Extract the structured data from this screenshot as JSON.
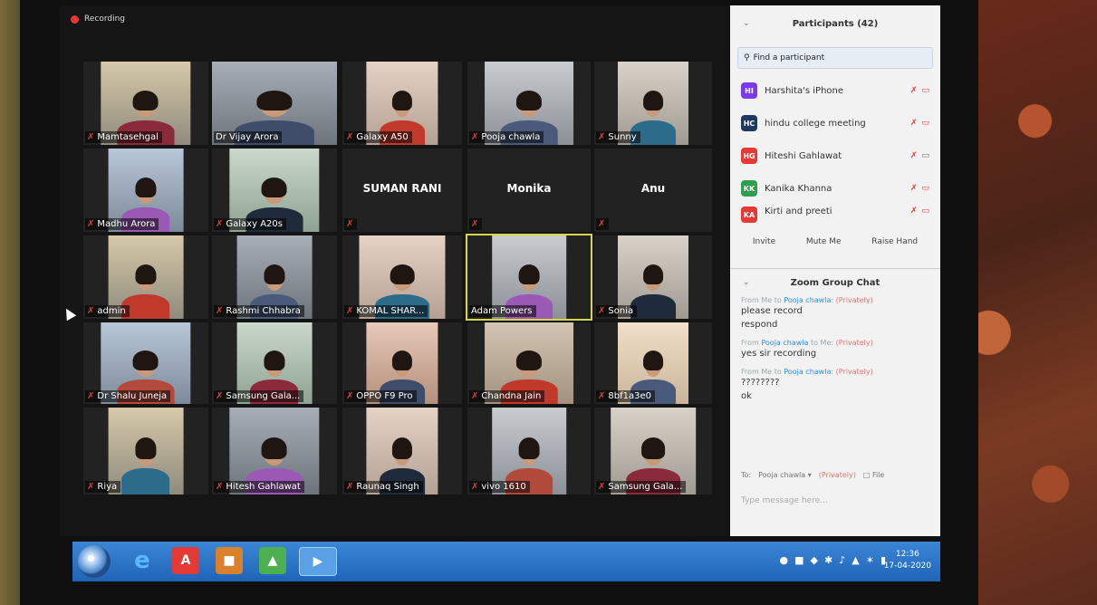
{
  "recording_label": "Recording",
  "video_tiles": [
    {
      "name": "Mamtasehgal",
      "muted": true
    },
    {
      "name": "Dr Vijay Arora",
      "muted": false
    },
    {
      "name": "Galaxy A50",
      "muted": true
    },
    {
      "name": "Pooja chawla",
      "muted": true
    },
    {
      "name": "Sunny",
      "muted": true
    },
    {
      "name": "Madhu Arora",
      "muted": true
    },
    {
      "name": "Galaxy A20s",
      "muted": true
    },
    {
      "name": "SUMAN RANI",
      "muted": true,
      "video_off": true
    },
    {
      "name": "Monika",
      "muted": true,
      "video_off": true
    },
    {
      "name": "Anu",
      "muted": true,
      "video_off": true
    },
    {
      "name": "admin",
      "muted": true
    },
    {
      "name": "Rashmi Chhabra",
      "muted": true
    },
    {
      "name": "KOMAL SHAR...",
      "muted": true
    },
    {
      "name": "Adam Powers",
      "muted": false,
      "active_speaker": true
    },
    {
      "name": "Sonia",
      "muted": true
    },
    {
      "name": "Dr Shalu Juneja",
      "muted": true
    },
    {
      "name": "Samsung Gala...",
      "muted": true
    },
    {
      "name": "OPPO F9 Pro",
      "muted": true
    },
    {
      "name": "Chandna Jain",
      "muted": true
    },
    {
      "name": "8bf1a3e0",
      "muted": true
    },
    {
      "name": "Riya",
      "muted": true
    },
    {
      "name": "Hitesh Gahlawat",
      "muted": true
    },
    {
      "name": "Raunaq Singh",
      "muted": true
    },
    {
      "name": "vivo 1610",
      "muted": true
    },
    {
      "name": "Samsung Gala...",
      "muted": true
    }
  ],
  "participants_panel": {
    "title": "Participants (42)",
    "search_placeholder": "Find a participant",
    "participants": [
      {
        "initials": "HI",
        "name": "Harshita's iPhone",
        "color": "#7c3aed"
      },
      {
        "initials": "HC",
        "name": "hindu college meeting",
        "color": "#1e3a5f"
      },
      {
        "initials": "HG",
        "name": "Hiteshi Gahlawat",
        "color": "#e53935"
      },
      {
        "initials": "KK",
        "name": "Kanika Khanna",
        "color": "#2e9e4f"
      },
      {
        "initials": "KA",
        "name": "Kirti and preeti",
        "color": "#e53935"
      }
    ],
    "actions": {
      "invite": "Invite",
      "mute_me": "Mute Me",
      "raise_hand": "Raise Hand"
    }
  },
  "chat": {
    "title": "Zoom Group Chat",
    "messages": [
      {
        "meta_prefix": "From Me to",
        "who": "Pooja chawla",
        "meta_suffix": "",
        "priv": "(Privately)",
        "lines": [
          "please record",
          "respond"
        ]
      },
      {
        "meta_prefix": "From",
        "who": "Pooja chawla",
        "meta_suffix": "to Me:",
        "priv": "(Privately)",
        "lines": [
          "yes sir recording"
        ]
      },
      {
        "meta_prefix": "From Me to",
        "who": "Pooja chawla",
        "meta_suffix": "",
        "priv": "(Privately)",
        "lines": [
          "????????",
          "ok"
        ]
      }
    ],
    "to_label": "To:",
    "to_value": "Pooja chawla",
    "to_private": "(Privately)",
    "file_label": "File",
    "input_placeholder": "Type message here..."
  },
  "taskbar": {
    "time": "12:36",
    "date": "17-04-2020"
  }
}
